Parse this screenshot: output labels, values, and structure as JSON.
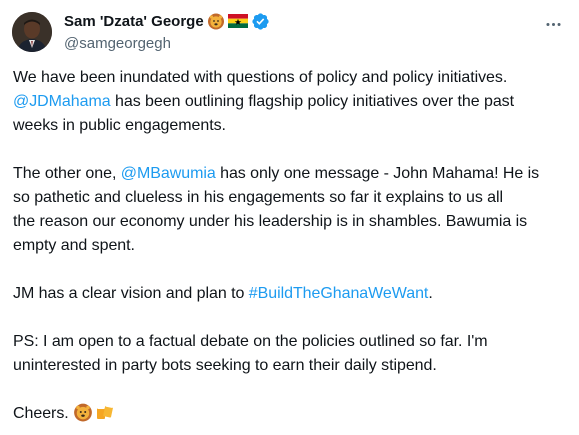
{
  "author": {
    "display_name": "Sam 'Dzata' George",
    "handle": "@samgeorgegh",
    "badge_emojis": [
      "lion-face-emoji",
      "ghana-flag-emoji"
    ],
    "verified_badge": "verified-badge-icon",
    "avatar_icon": "user-avatar"
  },
  "menu_icon": "more-horizontal-icon",
  "tweet": {
    "p1": {
      "l1": "We have been inundated with questions of policy and policy initiatives.",
      "l2_mention": "@JDMahama",
      "l2_text": " has been outlining flagship policy initiatives over the past",
      "l3": "weeks in public engagements."
    },
    "p2": {
      "l1_pre": "The other one, ",
      "l1_mention": "@MBawumia",
      "l1_post": " has only one message - John Mahama! He is",
      "l2": "so pathetic and clueless in his engagements so far it explains to us all",
      "l3": "the reason our economy under his leadership is in shambles. Bawumia is",
      "l4": "empty and spent."
    },
    "p3": {
      "pre": "JM has a clear vision and plan to ",
      "hashtag": "#BuildTheGhanaWeWant",
      "post": "."
    },
    "p4": {
      "l1": "PS: I am open to a factual debate on the policies outlined so far. I'm",
      "l2": "uninterested in party bots seeking to earn their daily stipend."
    },
    "p5": {
      "text": "Cheers.",
      "emojis": [
        "lion-face-emoji",
        "beer-mugs-emoji"
      ]
    }
  },
  "colors": {
    "text": "#0f1419",
    "secondary": "#536471",
    "link": "#1d9bf0",
    "verified": "#1d9bf0",
    "ghana_red": "#ce1126",
    "ghana_gold": "#fcd116",
    "ghana_green": "#006b3f"
  }
}
